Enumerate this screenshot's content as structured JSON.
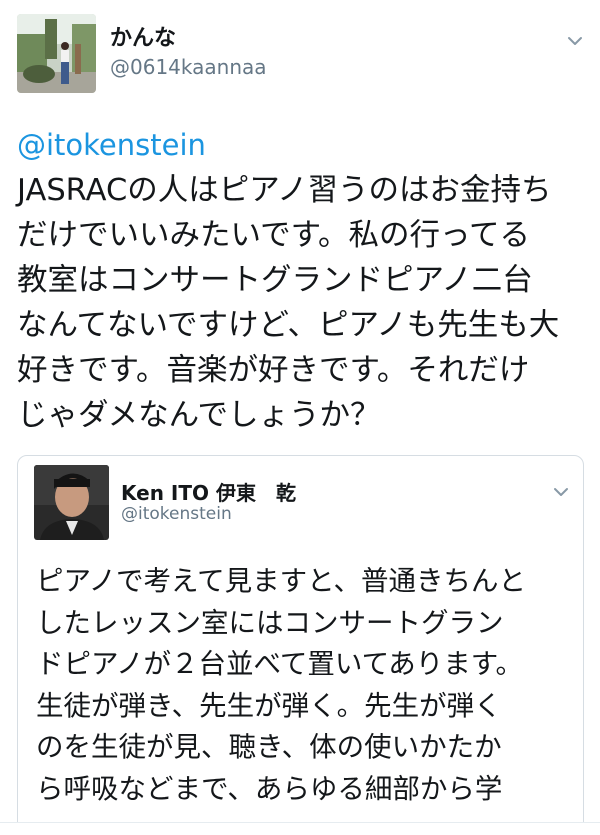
{
  "tweet": {
    "display_name": "かんな",
    "handle": "@0614kaannaa",
    "mention": "@itokenstein",
    "text_lines": [
      "JASRACの人はピアノ習うのはお金持ち",
      "だけでいいみたいです。私の行ってる",
      "教室はコンサートグランドピアノ二台",
      "なんてないですけど、ピアノも先生も大",
      "好きです。音楽が好きです。それだけ",
      "じゃダメなんでしょうか？"
    ]
  },
  "quoted": {
    "display_name": "Ken ITO 伊東　乾",
    "handle": "@itokenstein",
    "text_lines": [
      "ピアノで考えて見ますと、普通きちんと",
      "したレッスン室にはコンサートグラン",
      "ドピアノが２台並べて置いてあります。",
      "生徒が弾き、先生が弾く。先生が弾く",
      "のを生徒が見、聴き、体の使いかたか",
      "ら呼吸などまで、あらゆる細部から学"
    ]
  },
  "icons": {
    "menu_main": "chevron-down-icon",
    "menu_quote": "chevron-down-icon"
  },
  "colors": {
    "mention": "#1b95e0",
    "secondary_text": "#657786",
    "primary_text": "#14171a",
    "card_border": "#d6dde3"
  }
}
